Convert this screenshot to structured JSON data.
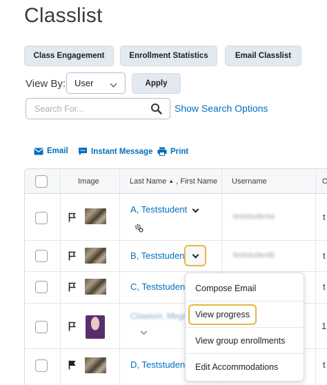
{
  "page": {
    "title": "Classlist"
  },
  "top_buttons": {
    "class_engagement": "Class Engagement",
    "enrollment_statistics": "Enrollment Statistics",
    "email_classlist": "Email Classlist"
  },
  "view_by": {
    "label": "View By:",
    "selected": "User",
    "apply": "Apply"
  },
  "search": {
    "placeholder": "Search For...",
    "show_options": "Show Search Options"
  },
  "actions": {
    "email": "Email",
    "instant_message": "Instant Message",
    "print": "Print"
  },
  "table": {
    "headers": {
      "image": "Image",
      "last_first": "Last Name",
      "first_name": ", First Name",
      "username": "Username",
      "cut": "O"
    },
    "rows": [
      {
        "name": "A, Teststudent",
        "username": "teststudenta",
        "cut": "t"
      },
      {
        "name": "B, Teststudent",
        "username": "teststudentb",
        "cut": "t"
      },
      {
        "name": "C, Teststudent",
        "cut": "t"
      },
      {
        "name": "Clawson, Megan",
        "cut": "1"
      },
      {
        "name": "D, Teststudent",
        "cut": "t"
      }
    ]
  },
  "context_menu": {
    "items": [
      "Compose Email",
      "View progress",
      "View group enrollments",
      "Edit Accommodations"
    ]
  },
  "colors": {
    "link": "#006fbf",
    "focus_ring": "#e7b73e",
    "button_bg": "#e3e9f1"
  }
}
